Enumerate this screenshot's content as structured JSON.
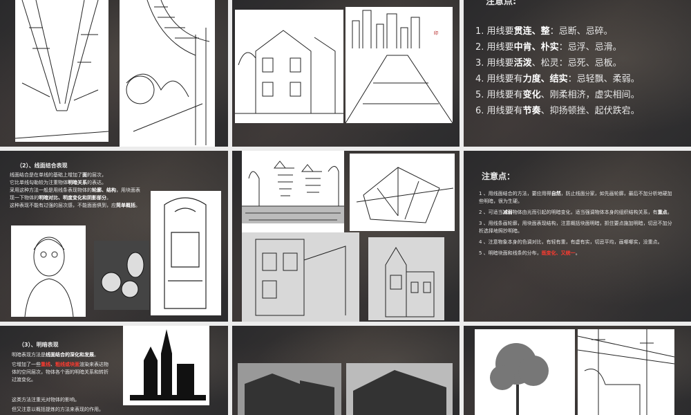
{
  "slides": {
    "s3": {
      "heading": "注意点:",
      "items": [
        {
          "num": "1.",
          "pre": "用线要",
          "bold": "贯连、整",
          "post": "：忌断、忌碎。"
        },
        {
          "num": "2.",
          "pre": "用线要",
          "bold": "中肯、朴实",
          "post": "：忌浮、忌滑。"
        },
        {
          "num": "3.",
          "pre": "用线要",
          "bold": "活泼",
          "post": "、松灵：忌死、忌板。"
        },
        {
          "num": "4.",
          "pre": "用线要有",
          "bold": "力度、结实",
          "post": "：忌轻飘、柔弱。"
        },
        {
          "num": "5.",
          "pre": "用线要有",
          "bold": "变化",
          "post": "、刚柔相济，虚实相间。"
        },
        {
          "num": "6.",
          "pre": "用线要有",
          "bold": "节奏",
          "post": "、抑扬顿挫、起伏跌宕。"
        }
      ]
    },
    "s4": {
      "heading": "（2）、线面结合表现",
      "l1a": "线面结合是在单线的基础上增加了",
      "l1b": "面",
      "l1c": "的层次，",
      "l2a": "它比单线勾勒较为注重物体",
      "l2b": "明暗关系",
      "l2c": "的表达。",
      "l3a": "采用这种方法一般是用线条表现物体的",
      "l3b": "轮廓、结构",
      "l3c": "，用块面表",
      "l4a": "现一下物体的",
      "l4b": "明暗对比、明度变化和阴影部分",
      "l4c": "。",
      "l5a": "这种表现不能有过强的层次感，不能面面俱到，应",
      "l5b": "简单概括",
      "l5c": "。"
    },
    "s6": {
      "heading": "注意点：",
      "p1a": "1 、用线面结合的方法，要应用得",
      "p1b": "自然",
      "p1c": "，防止线面分家，如先画轮廓，最后不加分析地硬加些明暗，很为生硬。",
      "p2a": "2 、可适当",
      "p2b": "减弱",
      "p2c": "物体由光而引起的明暗变化，适当强调物体本身的组织结构关系，有",
      "p2d": "重点",
      "p2e": "。",
      "p3": "3 、用线条画轮廓，用块面表现结构，注意概括块面明暗，抓住要点施加明暗，切忌不加分析选择地照抄明暗。",
      "p4": "4 、注意物象本身的色调对比，有轻有重，有虚有实，切忌平均，画哪哪实，没重点。",
      "p5a": "5 、明暗块面和线条的分布，",
      "p5b": "既变化、又统一",
      "p5c": "。"
    },
    "s7": {
      "heading": "（3）、明暗表现",
      "l1a": "明暗表现方法是",
      "l1b": "线面结合的深化和发展",
      "l1c": "。",
      "l2a": "它增加了一些",
      "l2b": "重线",
      "l2c": "、",
      "l2d": "粗线或块面",
      "l2e": "渲染来表达物体的空间层次，物体各个面的明暗关系和转折过渡变化。",
      "l3": "这类方法注重光对物体的影响。",
      "l4": "但又注意以概括提炼的方法来表现的作用。"
    }
  }
}
